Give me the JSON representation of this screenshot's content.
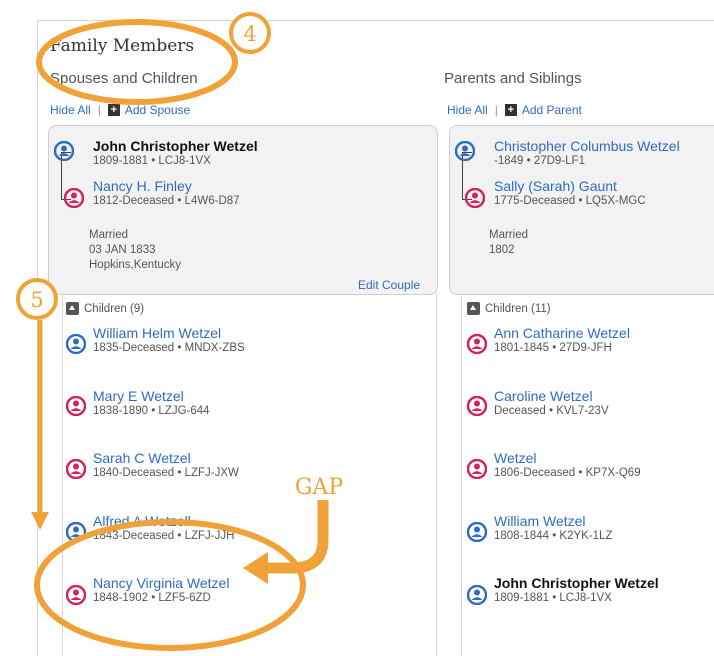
{
  "title": "Family Members",
  "left": {
    "heading": "Spouses and Children",
    "hide_all": "Hide All",
    "add_label": "Add Spouse",
    "couple": {
      "husband": {
        "name": "John Christopher Wetzel",
        "info": "1809-1881  •  LCJ8-1VX"
      },
      "wife": {
        "name": "Nancy H. Finley",
        "info": "1812-Deceased  •  L4W6-D87"
      },
      "marriage_label": "Married",
      "marriage_date": "03 JAN 1833",
      "marriage_place": "Hopkins,Kentucky",
      "edit": "Edit Couple"
    },
    "children_header": "Children (9)",
    "children": [
      {
        "name": "William Helm Wetzel",
        "info": "1835-Deceased  •  MNDX-ZBS",
        "gender": "male"
      },
      {
        "name": "Mary E Wetzel",
        "info": "1838-1890  •  LZJG-644",
        "gender": "female"
      },
      {
        "name": "Sarah C Wetzel",
        "info": "1840-Deceased  •  LZFJ-JXW",
        "gender": "female"
      },
      {
        "name": "Alfred A Wetzell",
        "info": "1843-Deceased  •  LZFJ-JJH",
        "gender": "male"
      },
      {
        "name": "Nancy Virginia Wetzel",
        "info": "1848-1902  •  LZF5-6ZD",
        "gender": "female"
      }
    ]
  },
  "right": {
    "heading": "Parents and Siblings",
    "hide_all": "Hide All",
    "add_label": "Add Parent",
    "couple": {
      "husband": {
        "name": "Christopher Columbus Wetzel",
        "info": "-1849  •  27D9-LF1"
      },
      "wife": {
        "name": "Sally (Sarah) Gaunt",
        "info": "1775-Deceased  •  LQ5X-MGC"
      },
      "marriage_label": "Married",
      "marriage_date": "1802"
    },
    "children_header": "Children (11)",
    "children": [
      {
        "name": "Ann Catharine Wetzel",
        "info": "1801-1845  •  27D9-JFH",
        "gender": "female"
      },
      {
        "name": "Caroline Wetzel",
        "info": "Deceased  •  KVL7-23V",
        "gender": "female"
      },
      {
        "name": "Wetzel",
        "info": "1806-Deceased  •  KP7X-Q69",
        "gender": "female"
      },
      {
        "name": "William Wetzel",
        "info": "1808-1844  •  K2YK-1LZ",
        "gender": "male"
      },
      {
        "name": "John Christopher Wetzel",
        "info": "1809-1881  •  LCJ8-1VX",
        "gender": "male",
        "current": true
      }
    ]
  },
  "annotations": {
    "step4": "4",
    "step5": "5",
    "gap_label": "GAP",
    "color": "#f0a137"
  },
  "colors": {
    "link": "#2f6bc4",
    "male": "#2f6bc4",
    "female": "#d1235a"
  },
  "icons": {
    "male": "person-male-icon",
    "female": "person-female-icon",
    "plus": "plus-square-icon",
    "caret": "caret-up-icon"
  }
}
